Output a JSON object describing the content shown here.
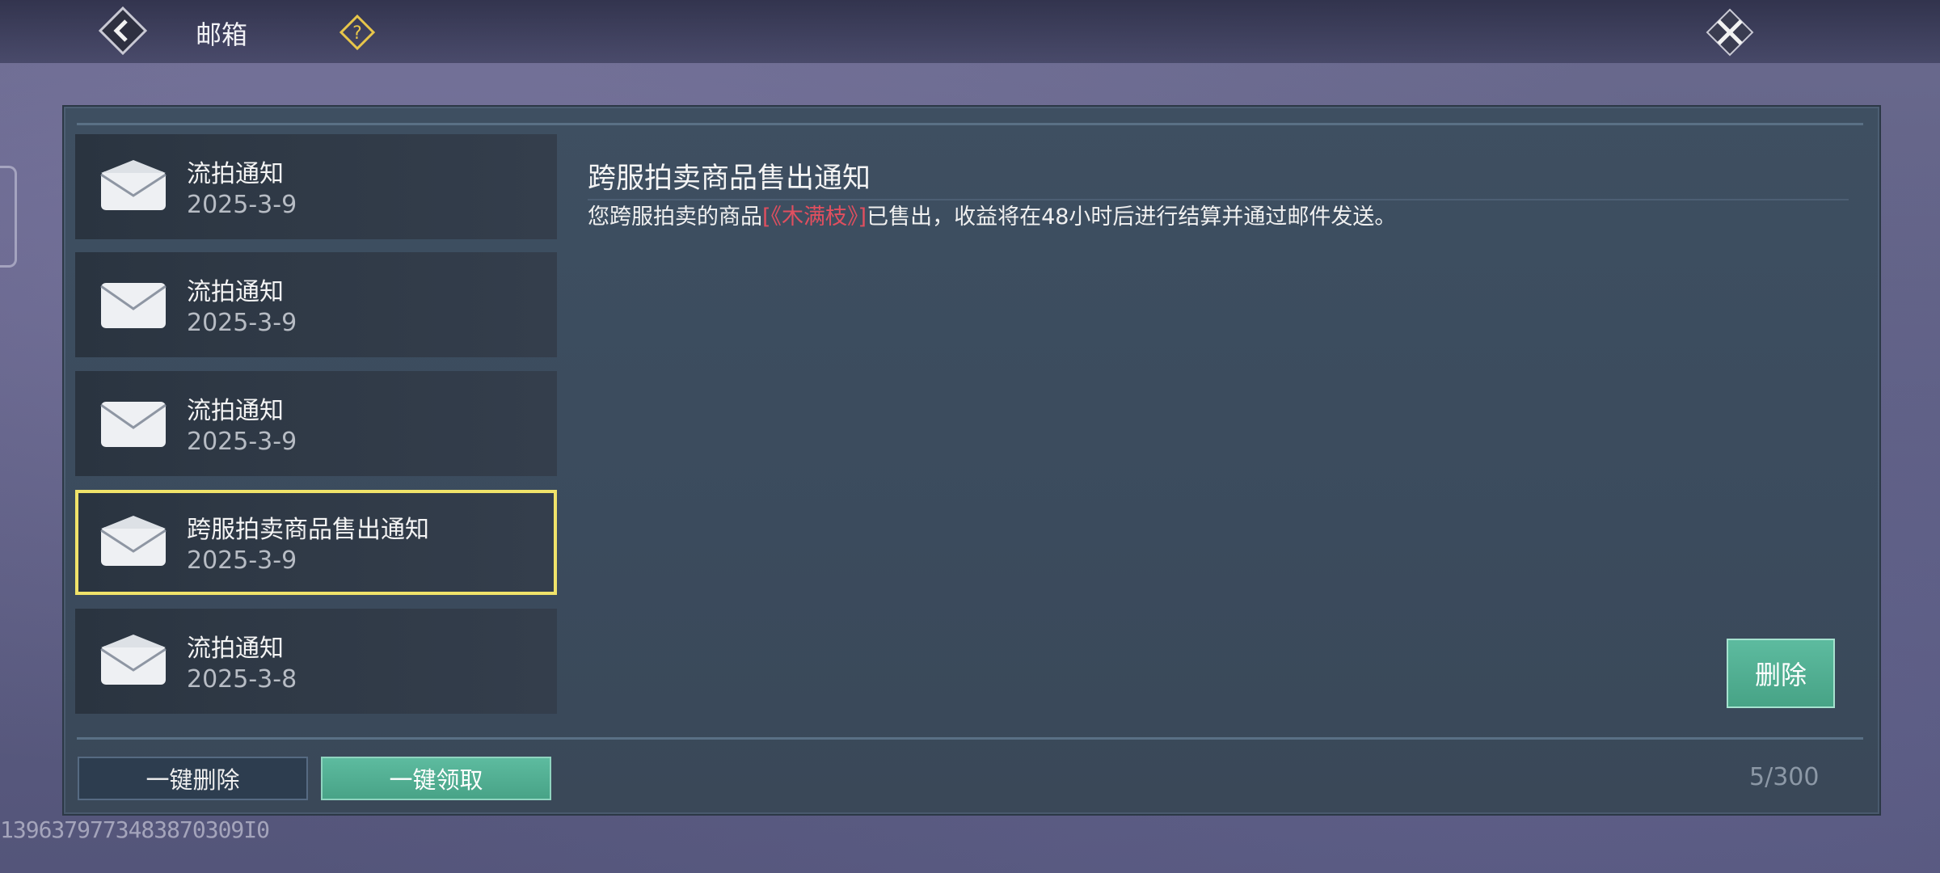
{
  "header": {
    "title": "邮箱",
    "back_icon": "back-arrow-icon",
    "help_icon": "question-diamond-icon",
    "close_icon": "close-x-icon"
  },
  "mail_list": [
    {
      "title": "流拍通知",
      "date": "2025-3-9",
      "selected": false
    },
    {
      "title": "流拍通知",
      "date": "2025-3-9",
      "selected": false
    },
    {
      "title": "流拍通知",
      "date": "2025-3-9",
      "selected": false
    },
    {
      "title": "跨服拍卖商品售出通知",
      "date": "2025-3-9",
      "selected": true
    },
    {
      "title": "流拍通知",
      "date": "2025-3-8",
      "selected": false
    }
  ],
  "detail": {
    "title": "跨服拍卖商品售出通知",
    "body_prefix": "您跨服拍卖的商品",
    "item_name": "[《木满枝》]",
    "body_suffix": "已售出，收益将在48小时后进行结算并通过邮件发送。"
  },
  "actions": {
    "delete_label": "删除",
    "bulk_delete_label": "一键删除",
    "bulk_claim_label": "一键领取"
  },
  "counter": "5/300",
  "uid": "1396379773483870309I0",
  "colors": {
    "accent_green": "#4fae90",
    "selected_border": "#f0e36a",
    "item_highlight": "#e04f5f"
  }
}
